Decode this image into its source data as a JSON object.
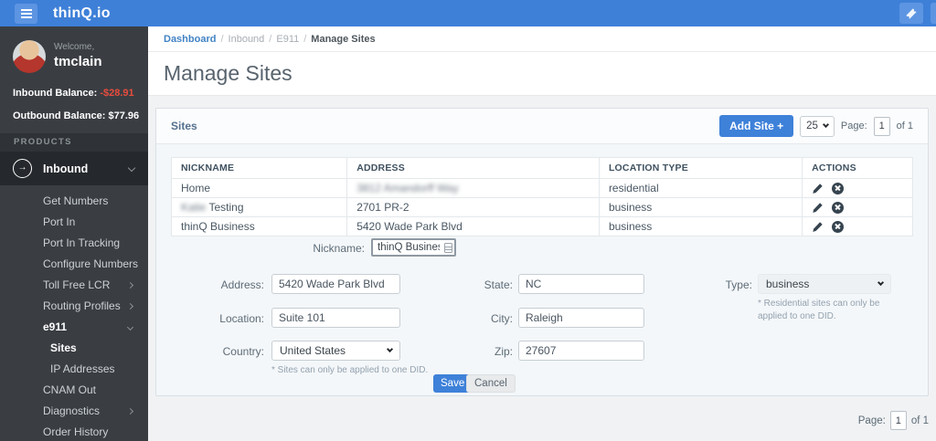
{
  "colors": {
    "header_blue": "#3e80d8",
    "accent_blue": "#3e81d9",
    "negative_red": "#e84c3d",
    "sidebar_dark": "#3a3e43",
    "link_blue": "#4183c4"
  },
  "header": {
    "logo": "thinQ.io"
  },
  "sidebar": {
    "welcome": "Welcome,",
    "username": "tmclain",
    "inbound_balance_label": "Inbound Balance:",
    "inbound_balance_value": "-$28.91",
    "outbound_balance_label": "Outbound Balance:",
    "outbound_balance_value": "$77.96",
    "products_header": "PRODUCTS",
    "inbound_menu_label": "Inbound",
    "inbound_icon": "arrow-in-circle-icon",
    "items": [
      {
        "label": "Get Numbers"
      },
      {
        "label": "Port In"
      },
      {
        "label": "Port In Tracking"
      },
      {
        "label": "Configure Numbers"
      },
      {
        "label": "Toll Free LCR"
      },
      {
        "label": "Routing Profiles"
      },
      {
        "label": "e911"
      },
      {
        "label": "Sites"
      },
      {
        "label": "IP Addresses"
      },
      {
        "label": "CNAM Out"
      },
      {
        "label": "Diagnostics"
      },
      {
        "label": "Order History"
      }
    ]
  },
  "breadcrumb": {
    "items": [
      "Dashboard",
      "Inbound",
      "E911",
      "Manage Sites"
    ],
    "separator": "/"
  },
  "page": {
    "title": "Manage Sites"
  },
  "panel": {
    "title": "Sites",
    "add_button_label": "Add Site +",
    "per_page": "25",
    "page_label": "Page:",
    "page_value": "1",
    "page_of_label": "of 1"
  },
  "table": {
    "headers": [
      "NICKNAME",
      "ADDRESS",
      "LOCATION TYPE",
      "ACTIONS"
    ],
    "rows": [
      {
        "nickname": "Home",
        "nickname_blurred": "",
        "address": "",
        "address_blurred": "3812 Amandorff Way",
        "location_type": "residential"
      },
      {
        "nickname": "Testing",
        "nickname_blurred": "Katie",
        "address": "2701 PR-2",
        "address_blurred": "",
        "location_type": "business"
      },
      {
        "nickname": "thinQ Business",
        "nickname_blurred": "",
        "address": "5420 Wade Park Blvd",
        "address_blurred": "",
        "location_type": "business"
      }
    ]
  },
  "form": {
    "nickname_label": "Nickname:",
    "nickname_value": "thinQ Business",
    "address_label": "Address:",
    "address_value": "5420 Wade Park Blvd",
    "state_label": "State:",
    "state_value": "NC",
    "type_label": "Type:",
    "type_value": "business",
    "type_note": "* Residential sites can only be applied to one DID.",
    "location_label": "Location:",
    "location_value": "Suite 101",
    "city_label": "City:",
    "city_value": "Raleigh",
    "country_label": "Country:",
    "country_value": "United States",
    "country_note": "* Sites can only be applied to one DID.",
    "zip_label": "Zip:",
    "zip_value": "27607",
    "save_label": "Save",
    "cancel_label": "Cancel"
  },
  "footer": {
    "page_label": "Page:",
    "page_value": "1",
    "page_of_label": "of 1"
  }
}
